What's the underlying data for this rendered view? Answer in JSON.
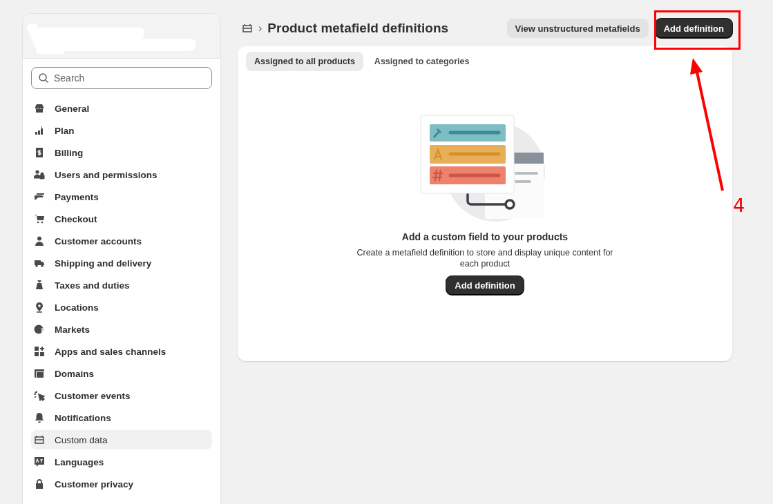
{
  "sidebar": {
    "search": {
      "placeholder": "Search"
    },
    "items": [
      {
        "label": "General",
        "selected": false
      },
      {
        "label": "Plan",
        "selected": false
      },
      {
        "label": "Billing",
        "selected": false
      },
      {
        "label": "Users and permissions",
        "selected": false
      },
      {
        "label": "Payments",
        "selected": false
      },
      {
        "label": "Checkout",
        "selected": false
      },
      {
        "label": "Customer accounts",
        "selected": false
      },
      {
        "label": "Shipping and delivery",
        "selected": false
      },
      {
        "label": "Taxes and duties",
        "selected": false
      },
      {
        "label": "Locations",
        "selected": false
      },
      {
        "label": "Markets",
        "selected": false
      },
      {
        "label": "Apps and sales channels",
        "selected": false
      },
      {
        "label": "Domains",
        "selected": false
      },
      {
        "label": "Customer events",
        "selected": false
      },
      {
        "label": "Notifications",
        "selected": false
      },
      {
        "label": "Custom data",
        "selected": true
      },
      {
        "label": "Languages",
        "selected": false
      },
      {
        "label": "Customer privacy",
        "selected": false
      }
    ]
  },
  "header": {
    "separator": "›",
    "title": "Product metafield definitions",
    "buttons": [
      {
        "label": "View unstructured metafields",
        "kind": "secondary"
      },
      {
        "label": "Add definition",
        "kind": "primary"
      }
    ]
  },
  "tabs": [
    {
      "label": "Assigned to all products",
      "selected": true
    },
    {
      "label": "Assigned to categories",
      "selected": false
    }
  ],
  "empty_state": {
    "heading": "Add a custom field to your products",
    "text": "Create a metafield definition to store and display unique content for each product",
    "button": "Add definition"
  },
  "annotation": {
    "label": "4"
  }
}
